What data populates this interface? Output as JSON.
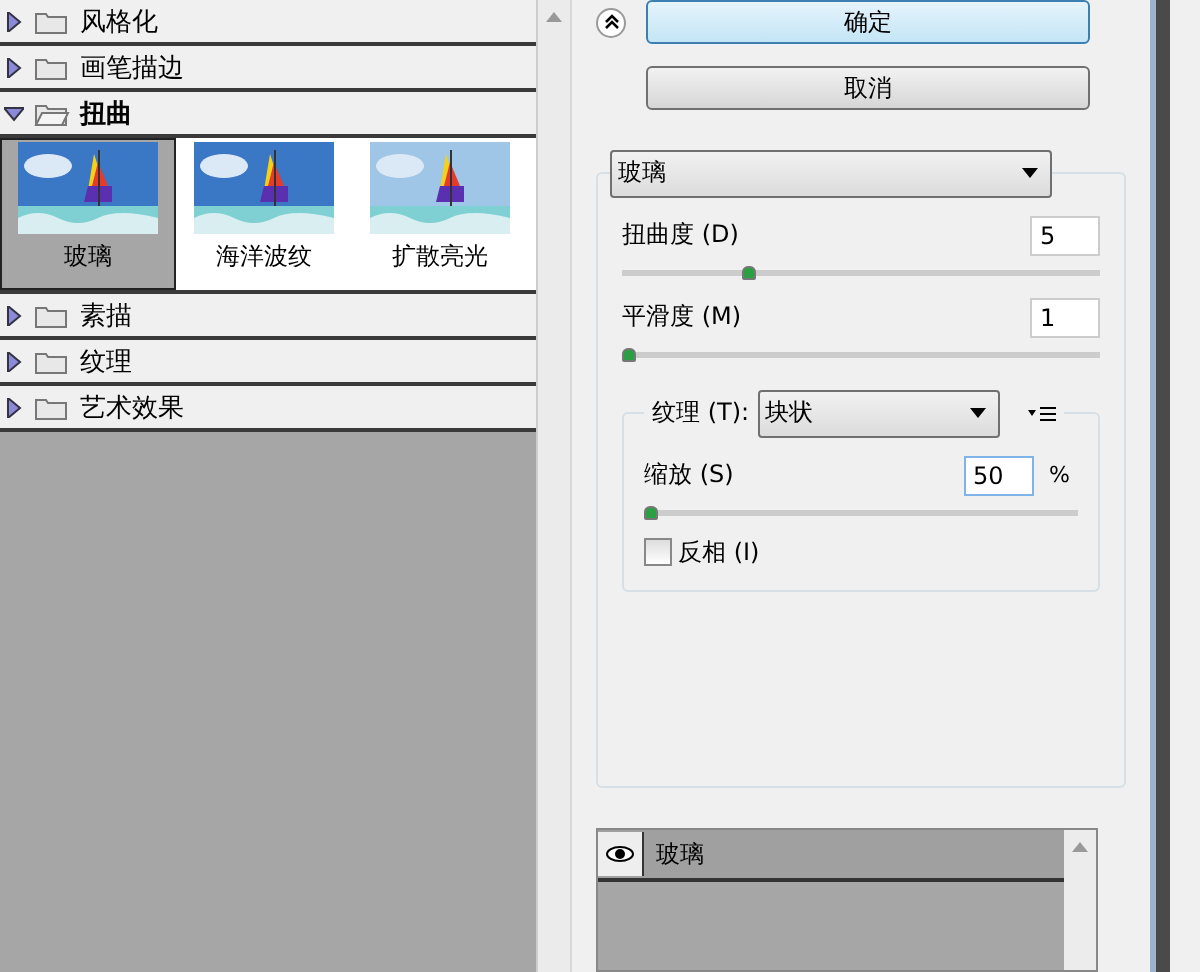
{
  "categories": [
    {
      "label": "风格化",
      "expanded": false
    },
    {
      "label": "画笔描边",
      "expanded": false
    },
    {
      "label": "扭曲",
      "expanded": true,
      "filters": [
        {
          "label": "玻璃",
          "selected": true,
          "kind": "picture"
        },
        {
          "label": "海洋波纹",
          "selected": false,
          "kind": "picture"
        },
        {
          "label": "扩散亮光",
          "selected": false,
          "kind": "picture"
        }
      ]
    },
    {
      "label": "素描",
      "expanded": false
    },
    {
      "label": "纹理",
      "expanded": false
    },
    {
      "label": "艺术效果",
      "expanded": false
    }
  ],
  "buttons": {
    "ok": "确定",
    "cancel": "取消"
  },
  "filter_select": "玻璃",
  "params": [
    {
      "label": "扭曲度 (D)",
      "value": "5",
      "level": 0.26
    },
    {
      "label": "平滑度 (M)",
      "value": "1",
      "level": 0
    }
  ],
  "texture": {
    "label": "纹理 (T):",
    "value": "块状",
    "scale": {
      "label": "缩放 (S)",
      "value": "50",
      "unit": "%",
      "level": 0
    },
    "invert": {
      "label": "反相 (I)",
      "checked": false
    }
  },
  "layers": [
    {
      "label": "玻璃",
      "visible": true
    }
  ]
}
